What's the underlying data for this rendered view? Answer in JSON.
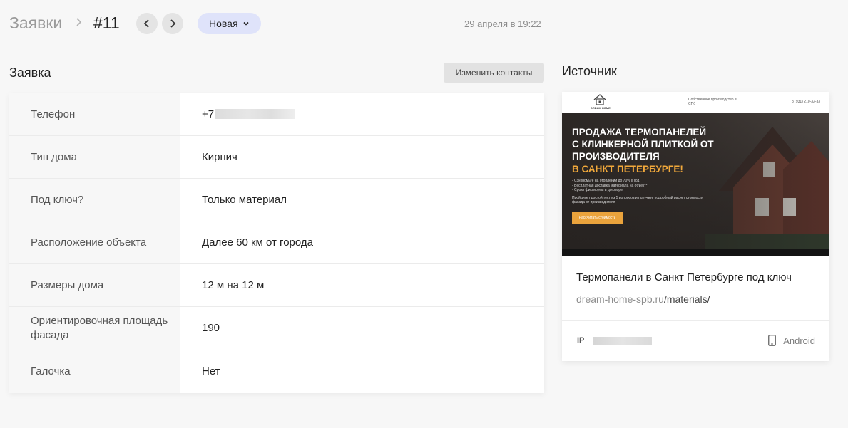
{
  "header": {
    "breadcrumb": "Заявки",
    "request_id": "#11",
    "status": "Новая",
    "date": "29 апреля в 19:22"
  },
  "request": {
    "title": "Заявка",
    "edit_contacts_label": "Изменить контакты",
    "rows": [
      {
        "label": "Телефон",
        "value": "+7"
      },
      {
        "label": "Тип дома",
        "value": "Кирпич"
      },
      {
        "label": "Под ключ?",
        "value": "Только материал"
      },
      {
        "label": "Расположение объекта",
        "value": "Далее 60 км от города"
      },
      {
        "label": "Размеры дома",
        "value": "12 м на 12 м"
      },
      {
        "label": "Ориентировочная площадь фасада",
        "value": "190"
      },
      {
        "label": "Галочка",
        "value": "Нет"
      }
    ]
  },
  "source": {
    "title": "Источник",
    "preview": {
      "logo": "DREAM HOME",
      "tagline": "Собственное производство в СПб",
      "phone": "8 (931) 210-33-33",
      "headline_line1": "ПРОДАЖА ТЕРМОПАНЕЛЕЙ",
      "headline_line2": "С КЛИНКЕРНОЙ ПЛИТКОЙ ОТ",
      "headline_line3": "ПРОИЗВОДИТЕЛЯ",
      "headline_accent": "В САНКТ ПЕТЕРБУРГЕ!",
      "bullet1": "- Сэкономьте на отоплении до 70% в год",
      "bullet2": "- Бесплатная доставка материала на объект*",
      "bullet3": "- Сроки фиксируем в договоре",
      "cta_text": "Пройдите простой тест из 5 вопросов и получите подробный расчет стоимости фасада от производителя",
      "button": "Рассчитать стоимость"
    },
    "page_title": "Термопанели в Санкт Петербурге под ключ",
    "url_host": "dream-home-spb.ru",
    "url_path": "/materials/",
    "ip_label": "IP",
    "device": "Android"
  },
  "colors": {
    "background": "#f7f7f7",
    "status_pill": "#dfe3fa",
    "accent_orange": "#f2a93b"
  }
}
